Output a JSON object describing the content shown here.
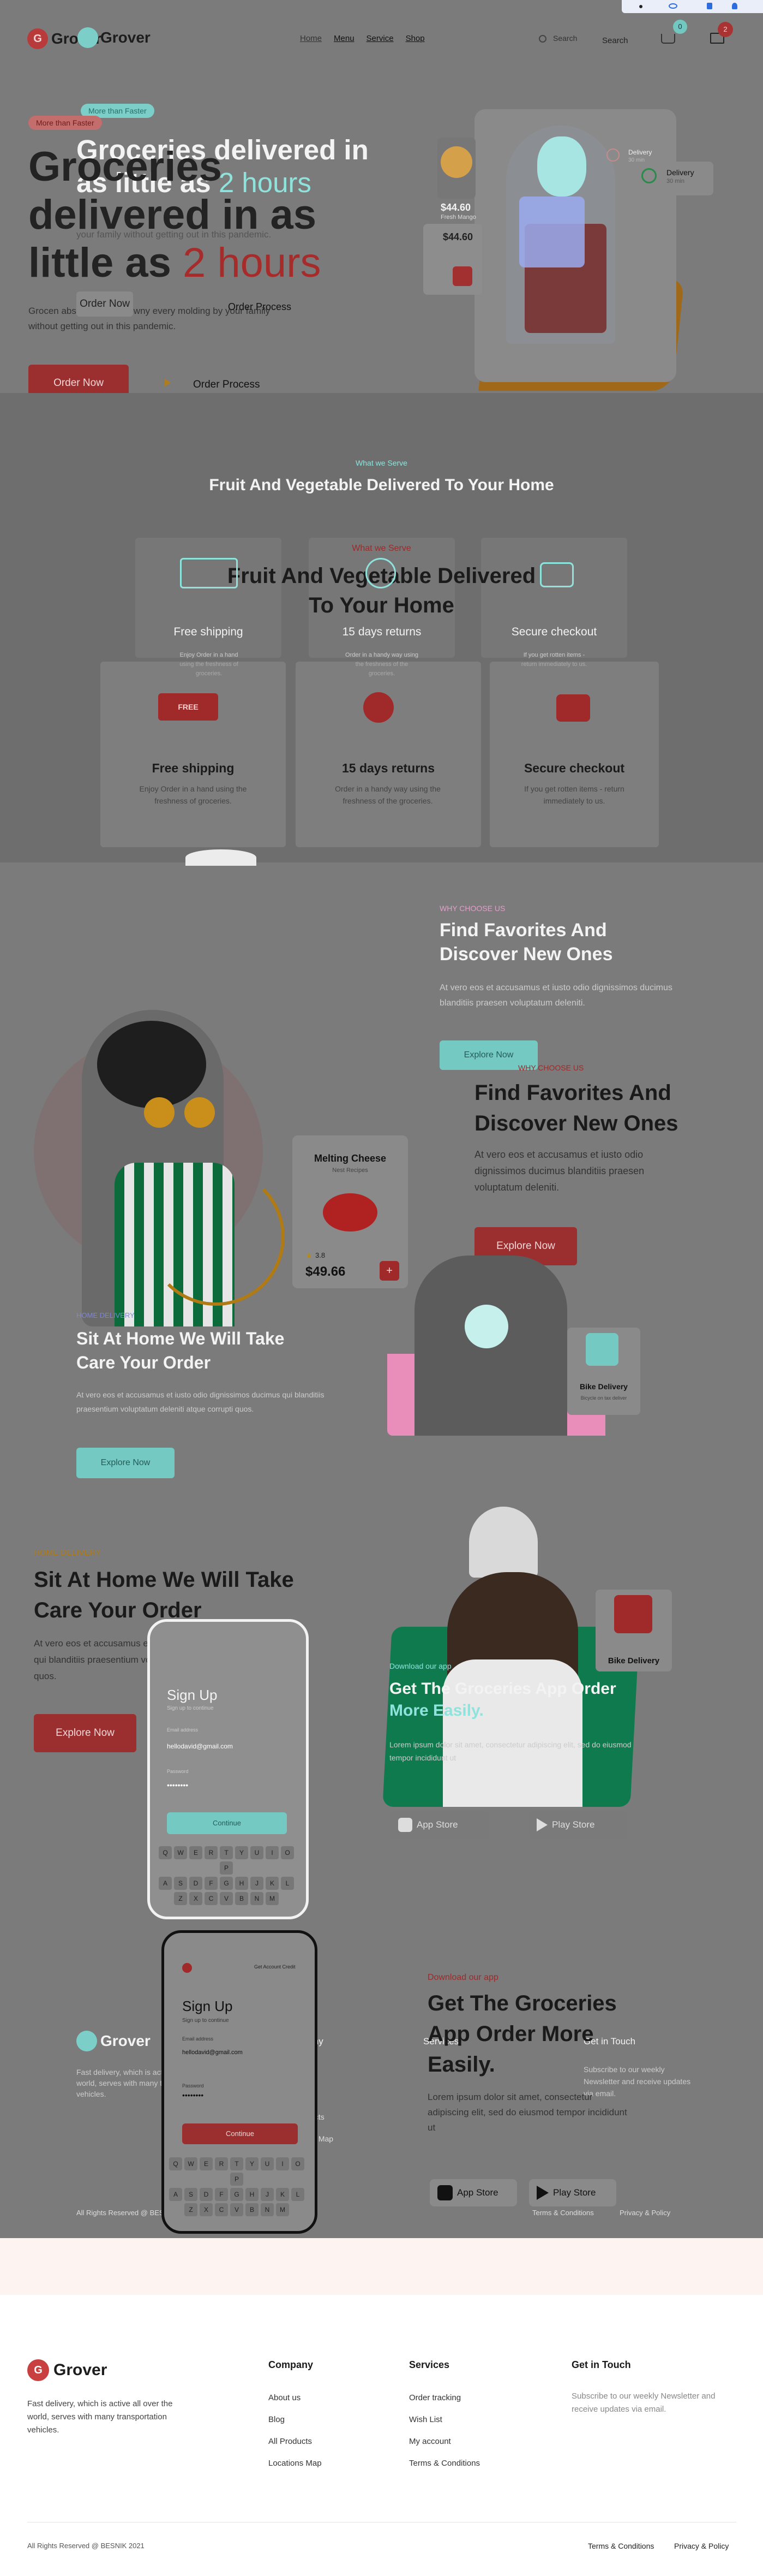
{
  "brand": {
    "name": "Grover",
    "name_echo": "Grover",
    "logo_letter": "G"
  },
  "nav": {
    "links": [
      "Home",
      "Menu",
      "Service",
      "Shop"
    ],
    "search_label": "Search",
    "search_echo": "Search",
    "cart_count": "2",
    "cart_count_echo": "0"
  },
  "hero": {
    "badge": "More than Faster",
    "badge_echo": "More than Faster",
    "title_line1": "Groceries delivered in",
    "title_line2_prefix": "as little as",
    "title_line2_accent": "2 hours",
    "ghost_line1": "Groceries",
    "ghost_line2": "delivered in as",
    "ghost_line3_prefix": "little as",
    "ghost_line3_accent": "2 hours",
    "subtitle": "Grocen abstore lobbe growny every molding by your family without getting out in this pandemic.",
    "subtitle_echo": "your family without getting out in this pandemic.",
    "order_now": "Order Now",
    "order_now_echo": "Order Now",
    "order_process": "Order Process",
    "order_process_echo": "Order Process",
    "price_card": {
      "price": "$44.60",
      "price_echo": "$44.60",
      "label": "Fresh Mango"
    },
    "delivery_card": {
      "title": "Delivery",
      "sub": "30 min",
      "title_echo": "Delivery",
      "sub_echo": "30 min"
    }
  },
  "serve": {
    "eyebrow": "What we Serve",
    "eyebrow_echo": "What we Serve",
    "title": "Fruit And Vegetable Delivered To Your Home",
    "ghost_title_line1": "Fruit And Vegetable Delivered",
    "ghost_title_line2": "To Your Home",
    "features": [
      {
        "title": "Free shipping",
        "text": "Enjoy Order in a hand using the freshness of groceries.",
        "icon": "truck-icon"
      },
      {
        "title": "15 days returns",
        "text": "Order in a handy way using the freshness of the groceries.",
        "icon": "money-hand-icon"
      },
      {
        "title": "Secure checkout",
        "text": "If you get rotten items - return immediately to us.",
        "icon": "chat-icon"
      }
    ],
    "truck_badge": "FREE"
  },
  "favorites": {
    "eyebrow": "WHY CHOOSE US",
    "eyebrow_echo": "WHY CHOOSE US",
    "title_line1": "Find Favorites And",
    "title_line2": "Discover New Ones",
    "text": "At vero eos et accusamus et iusto odio dignissimos ducimus blanditiis praesen voluptatum deleniti.",
    "button": "Explore Now",
    "button_echo": "Explore Now",
    "product": {
      "name": "Melting Cheese",
      "sub": "Nest Recipes",
      "rating": "3.8",
      "price": "$49.66"
    }
  },
  "home_delivery": {
    "eyebrow": "HOME DELIVERY",
    "eyebrow_echo": "HOME DELIVERY",
    "title_line1": "Sit At Home We Will Take",
    "title_line2": "Care Your Order",
    "text": "At vero eos et accusamus et iusto odio dignissimos ducimus qui blanditiis praesentium voluptatum deleniti atque corrupti quos.",
    "button": "Explore Now",
    "button_echo": "Explore Now",
    "bike_card": {
      "title": "Bike Delivery",
      "text": "Bicycle on tax deliver",
      "title_echo": "Bike Delivery",
      "text_echo": "Bicycle on tax deliver"
    }
  },
  "app": {
    "eyebrow": "Download our app",
    "eyebrow_echo": "Download our app",
    "title_line1": "Get The Groceries",
    "title_line2": "App Order More",
    "title_line3": "Easily.",
    "title_echo_line1": "Get The Groceries App Order",
    "title_echo_line2": "More Easily.",
    "text": "Lorem ipsum dolor sit amet, consectetur adipiscing elit, sed do eiusmod tempor incididunt ut",
    "app_store": "App Store",
    "play_store": "Play Store",
    "app_store_echo": "App Store",
    "play_store_echo": "Play Store",
    "phone": {
      "title": "Sign Up",
      "subtitle": "Sign up to continue",
      "email_label": "Email address",
      "email": "hellodavid@gmail.com",
      "password_label": "Password",
      "password": "••••••••",
      "button": "Continue",
      "top_link": "Get Account Credit",
      "keys_row1": [
        "Q",
        "W",
        "E",
        "R",
        "T",
        "Y",
        "U",
        "I",
        "O",
        "P"
      ],
      "keys_row2": [
        "A",
        "S",
        "D",
        "F",
        "G",
        "H",
        "J",
        "K",
        "L"
      ],
      "keys_row3": [
        "Z",
        "X",
        "C",
        "V",
        "B",
        "N",
        "M"
      ]
    }
  },
  "footer": {
    "about": "Fast delivery, which is active all over the world, serves with many transportation vehicles.",
    "columns": [
      {
        "title": "Company",
        "links": [
          "About us",
          "Blog",
          "All Products",
          "Locations Map"
        ]
      },
      {
        "title": "Services",
        "links": [
          "Order tracking",
          "Wish List",
          "My account",
          "Terms & Conditions"
        ]
      }
    ],
    "contact_title": "Get in Touch",
    "contact_text": "Subscribe to our weekly Newsletter and receive updates via email.",
    "copyright": "All Rights Reserved @ BESNIK 2021",
    "legal": [
      "Terms & Conditions",
      "Privacy & Policy"
    ]
  },
  "colors": {
    "accent_red": "#c0392b",
    "accent_teal": "#8ee4dc",
    "overlay_gray": "#7b7b7b",
    "green": "#0e7a4e"
  }
}
